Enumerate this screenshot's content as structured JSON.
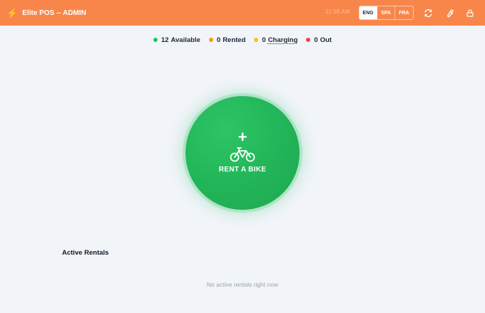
{
  "header": {
    "title": "Elite POS -- ADMIN",
    "brand_icon": "lightning-bolt-icon",
    "faint_text": "11:58 AM",
    "languages": [
      {
        "code": "ENG",
        "active": true
      },
      {
        "code": "SPA",
        "active": false
      },
      {
        "code": "FRA",
        "active": false
      }
    ],
    "icons": [
      "refresh-icon",
      "wrench-icon",
      "lock-icon"
    ],
    "bg_color": "#f8864a"
  },
  "status": [
    {
      "count": "12",
      "label": "Available",
      "color": "#22c55e"
    },
    {
      "count": "0",
      "label": "Rented",
      "color": "#f59e0b"
    },
    {
      "count": "0",
      "label": "Charging",
      "color": "#fbbf24"
    },
    {
      "count": "0",
      "label": "Out",
      "color": "#ef4444"
    }
  ],
  "rent_button": {
    "plus": "+",
    "icon": "bicycle-icon",
    "label": "RENT A BIKE",
    "color": "#22b458"
  },
  "rentals": {
    "title": "Active Rentals",
    "empty_message": "No active rentals right now"
  }
}
